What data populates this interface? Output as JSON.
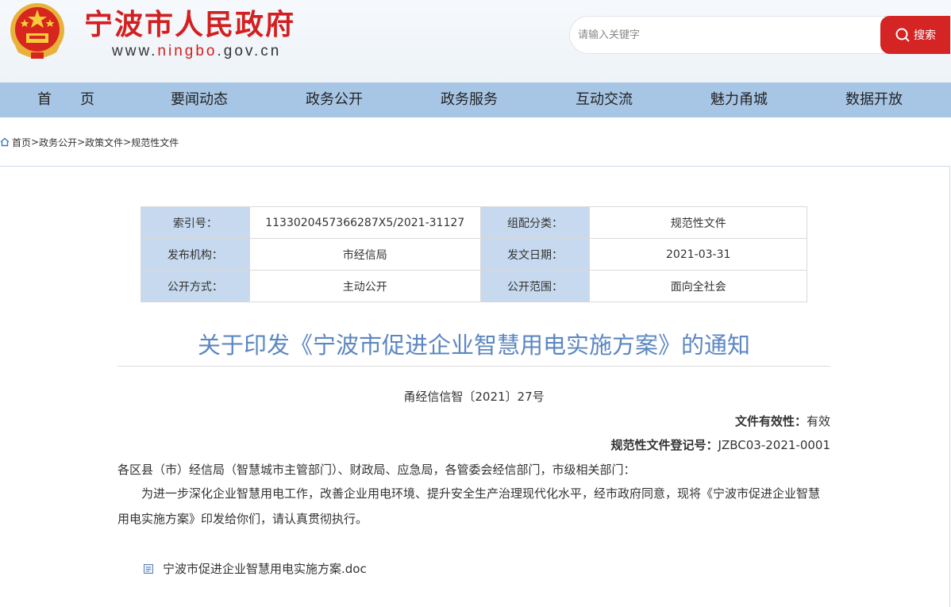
{
  "header": {
    "site_title": "宁波市人民政府",
    "site_url_prefix": "www.",
    "site_url_highlight": "ningbo",
    "site_url_suffix": ".gov.cn",
    "search_placeholder": "请输入关键字",
    "search_button_label": "搜索",
    "brand_red": "#d31f1f"
  },
  "nav": {
    "items": [
      {
        "label": "首　　页"
      },
      {
        "label": "要闻动态"
      },
      {
        "label": "政务公开"
      },
      {
        "label": "政务服务"
      },
      {
        "label": "互动交流"
      },
      {
        "label": "魅力甬城"
      },
      {
        "label": "数据开放"
      }
    ],
    "background": "#a7c6e6"
  },
  "breadcrumb": {
    "items": [
      "首页",
      "政务公开",
      "政策文件",
      "规范性文件"
    ],
    "separator": ">"
  },
  "meta": {
    "rows": [
      {
        "label1": "索引号：",
        "value1": "1133020457366287X5/2021-31127",
        "label2": "组配分类：",
        "value2": "规范性文件"
      },
      {
        "label1": "发布机构：",
        "value1": "市经信局",
        "label2": "发文日期：",
        "value2": "2021-03-31"
      },
      {
        "label1": "公开方式：",
        "value1": "主动公开",
        "label2": "公开范围：",
        "value2": "面向全社会"
      }
    ]
  },
  "article": {
    "title": "关于印发《宁波市促进企业智慧用电实施方案》的通知",
    "doc_number": "甬经信信智〔2021〕27号",
    "validity_label": "文件有效性：",
    "validity_value": "有效",
    "reg_label": "规范性文件登记号：",
    "reg_value": "JZBC03-2021-0001",
    "addressee": "各区县（市）经信局（智慧城市主管部门）、财政局、应急局，各管委会经信部门，市级相关部门：",
    "body": "为进一步深化企业智慧用电工作，改善企业用电环境、提升安全生产治理现代化水平，经市政府同意，现将《宁波市促进企业智慧用电实施方案》印发给你们，请认真贯彻执行。",
    "attachment": "宁波市促进企业智慧用电实施方案.doc"
  }
}
